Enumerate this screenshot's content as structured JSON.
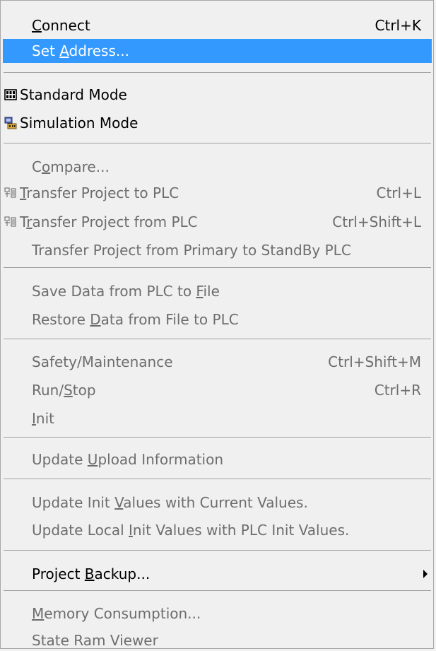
{
  "menu": {
    "items": [
      {
        "label": "Connect",
        "shortcut": "Ctrl+K",
        "mnemonic": 0
      },
      {
        "label": "Set Address...",
        "shortcut": "",
        "mnemonic": 4
      },
      {
        "label": "Standard Mode",
        "shortcut": "",
        "mnemonic": -1
      },
      {
        "label": "Simulation Mode",
        "shortcut": "",
        "mnemonic": -1
      },
      {
        "label": "Compare...",
        "shortcut": "",
        "mnemonic": 1
      },
      {
        "label": "Transfer Project to PLC",
        "shortcut": "Ctrl+L",
        "mnemonic": 0
      },
      {
        "label": "Transfer Project from PLC",
        "shortcut": "Ctrl+Shift+L",
        "mnemonic": 1
      },
      {
        "label": "Transfer Project from Primary to StandBy PLC",
        "shortcut": "",
        "mnemonic": -1
      },
      {
        "label": "Save Data from PLC to File",
        "shortcut": "",
        "mnemonic": 22
      },
      {
        "label": "Restore Data from File to PLC",
        "shortcut": "",
        "mnemonic": 8
      },
      {
        "label": "Safety/Maintenance",
        "shortcut": "Ctrl+Shift+M",
        "mnemonic": -1
      },
      {
        "label": "Run/Stop",
        "shortcut": "Ctrl+R",
        "mnemonic": 4
      },
      {
        "label": "Init",
        "shortcut": "",
        "mnemonic": 0
      },
      {
        "label": "Update Upload Information",
        "shortcut": "",
        "mnemonic": 7
      },
      {
        "label": "Update Init Values with Current Values.",
        "shortcut": "",
        "mnemonic": 12
      },
      {
        "label": "Update Local Init Values with PLC Init Values.",
        "shortcut": "",
        "mnemonic": 13
      },
      {
        "label": "Project Backup...",
        "shortcut": "",
        "mnemonic": 8
      },
      {
        "label": "Memory Consumption...",
        "shortcut": "",
        "mnemonic": 0
      },
      {
        "label": "State Ram Viewer",
        "shortcut": "",
        "mnemonic": -1
      }
    ]
  },
  "icons": {
    "standard_mode": "standard-mode-icon",
    "simulation_mode": "simulation-mode-icon",
    "transfer_to_plc": "transfer-to-plc-icon",
    "transfer_from_plc": "transfer-from-plc-icon",
    "submenu_arrow": "submenu-arrow-icon"
  },
  "colors": {
    "menu_background": "#f0f0f0",
    "highlight": "#3399ff",
    "highlight_text": "#ffffff",
    "text": "#000000",
    "disabled_text": "#6d6d6d",
    "separator": "#a0a0a0"
  }
}
